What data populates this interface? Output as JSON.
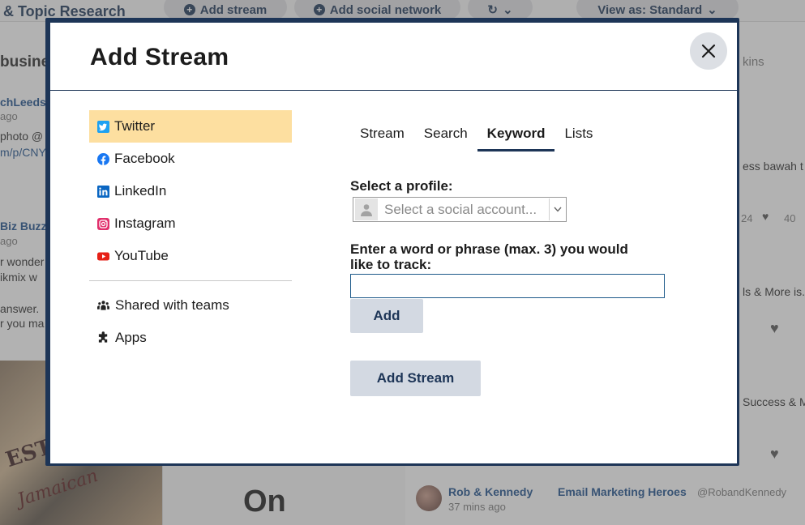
{
  "background": {
    "app_title": "& Topic Research",
    "add_stream_pill": "Add stream",
    "add_social_pill": "Add social network",
    "view_as_pill": "View as: Standard",
    "col1_header": "busine",
    "col1_lines": [
      "chLeeds",
      "ago",
      "photo @",
      "m/p/CNY",
      "Biz Buzz",
      "ago",
      "r wonder",
      "ikmix w",
      "answer.",
      "r you ma"
    ],
    "right_lines": [
      "kins",
      "ess bawah t",
      "24",
      "40",
      "ls & More is.",
      "Success & M"
    ],
    "big_word": "On",
    "post_author": "Rob & Kennedy",
    "post_group": "Email Marketing Heroes",
    "post_handle": "@RobandKennedy",
    "post_time": "37 mins ago",
    "photo_text_1": "ESTIV",
    "photo_text_2": "Jamaican"
  },
  "modal": {
    "title": "Add Stream",
    "networks": [
      {
        "label": "Twitter",
        "icon": "twitter-icon",
        "color": "#1da1f2",
        "active": true
      },
      {
        "label": "Facebook",
        "icon": "facebook-icon",
        "color": "#1877f2",
        "active": false
      },
      {
        "label": "LinkedIn",
        "icon": "linkedin-icon",
        "color": "#0a66c2",
        "active": false
      },
      {
        "label": "Instagram",
        "icon": "instagram-icon",
        "color": "#e1306c",
        "active": false
      },
      {
        "label": "YouTube",
        "icon": "youtube-icon",
        "color": "#e62117",
        "active": false
      }
    ],
    "extras": [
      {
        "label": "Shared with teams",
        "icon": "team-icon"
      },
      {
        "label": "Apps",
        "icon": "puzzle-icon"
      }
    ],
    "tabs": [
      {
        "label": "Stream",
        "active": false
      },
      {
        "label": "Search",
        "active": false
      },
      {
        "label": "Keyword",
        "active": true
      },
      {
        "label": "Lists",
        "active": false
      }
    ],
    "profile_label": "Select a profile:",
    "profile_placeholder": "Select a social account...",
    "keyword_label_line1": "Enter a word or phrase (max. 3) you would",
    "keyword_label_line2": "like to track:",
    "keyword_value": "",
    "add_label": "Add",
    "add_stream_label": "Add Stream"
  },
  "colors": {
    "brand": "#1d3557",
    "active_item": "#fddfa0",
    "button_bg": "#d3d9e2"
  }
}
